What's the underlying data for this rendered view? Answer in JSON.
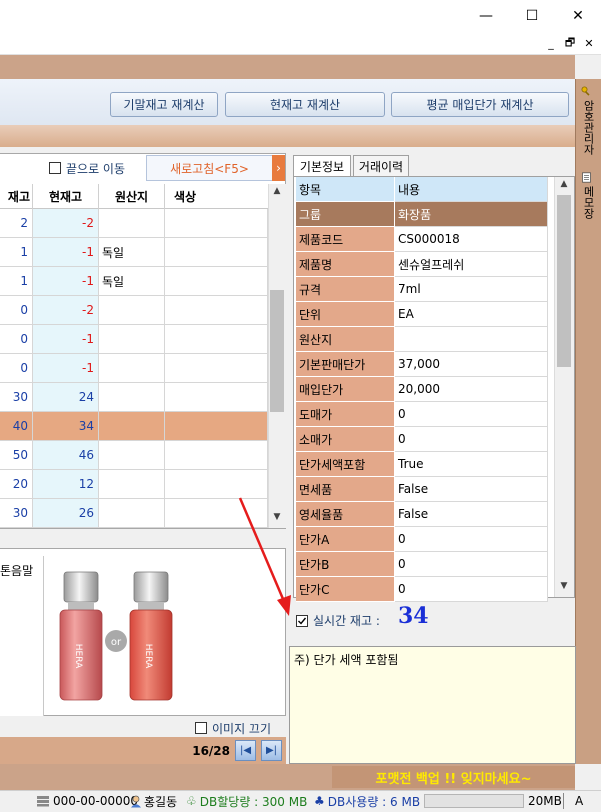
{
  "window": {
    "min": "—",
    "max": "☐",
    "close": "✕"
  },
  "mdi": {
    "min": "_",
    "restore": "🗗",
    "close": "✕"
  },
  "toolbar": {
    "buttons": [
      "기말재고 재계산",
      "현재고 재계산",
      "평균 매입단가 재계산"
    ]
  },
  "side_tabs": [
    "암호관리자",
    "메모장"
  ],
  "grid": {
    "move_to_end_label": "끝으로 이동",
    "refresh_label": "새로고침<F5>",
    "refresh_arrow": "›",
    "columns": [
      "재고",
      "현재고",
      "원산지",
      "색상"
    ],
    "rows": [
      {
        "a": "2",
        "b": "-2",
        "c": ""
      },
      {
        "a": "1",
        "b": "-1",
        "c": "독일"
      },
      {
        "a": "1",
        "b": "-1",
        "c": "독일"
      },
      {
        "a": "0",
        "b": "-2",
        "c": ""
      },
      {
        "a": "0",
        "b": "-1",
        "c": ""
      },
      {
        "a": "0",
        "b": "-1",
        "c": ""
      },
      {
        "a": "30",
        "b": "24",
        "c": ""
      },
      {
        "a": "40",
        "b": "34",
        "c": ""
      },
      {
        "a": "50",
        "b": "46",
        "c": ""
      },
      {
        "a": "20",
        "b": "12",
        "c": ""
      },
      {
        "a": "30",
        "b": "26",
        "c": ""
      }
    ],
    "selected_row": 7
  },
  "image_panel": {
    "name_snippet": "톤음말",
    "brand_text": "HERA",
    "or_label": "or",
    "hide_image_label": "이미지 끄기",
    "page_indicator": "16/28",
    "prev": "|◀",
    "next": "▶|"
  },
  "props": {
    "tabs": [
      "기본정보",
      "거래이력"
    ],
    "header": {
      "k": "항목",
      "v": "내용"
    },
    "group": {
      "k": "그룹",
      "v": "화장품"
    },
    "rows": [
      {
        "k": "제품코드",
        "v": "CS000018"
      },
      {
        "k": "제품명",
        "v": "센슈얼프레쉬"
      },
      {
        "k": "규격",
        "v": "7ml"
      },
      {
        "k": "단위",
        "v": "EA"
      },
      {
        "k": "원산지",
        "v": ""
      },
      {
        "k": "기본판매단가",
        "v": "37,000"
      },
      {
        "k": "매입단가",
        "v": "20,000"
      },
      {
        "k": "도매가",
        "v": "0"
      },
      {
        "k": "소매가",
        "v": "0"
      },
      {
        "k": "단가세액포함",
        "v": "True"
      },
      {
        "k": "면세품",
        "v": "False"
      },
      {
        "k": "영세율품",
        "v": "False"
      },
      {
        "k": "단가A",
        "v": "0"
      },
      {
        "k": "단가B",
        "v": "0"
      },
      {
        "k": "단가C",
        "v": "0"
      }
    ]
  },
  "realtime": {
    "label": "실시간 재고 :",
    "value": "34"
  },
  "note": "주) 단가 세액 포함됨",
  "banner": "포맷전 백업 !! 잊지마세요~",
  "status": {
    "phone": "000-00-00000",
    "user": "홍길동",
    "db_alloc": "DB할당량 : 300 MB",
    "db_used": "DB사용량 : 6 MB",
    "mem": "20MB",
    "mode": "A"
  }
}
